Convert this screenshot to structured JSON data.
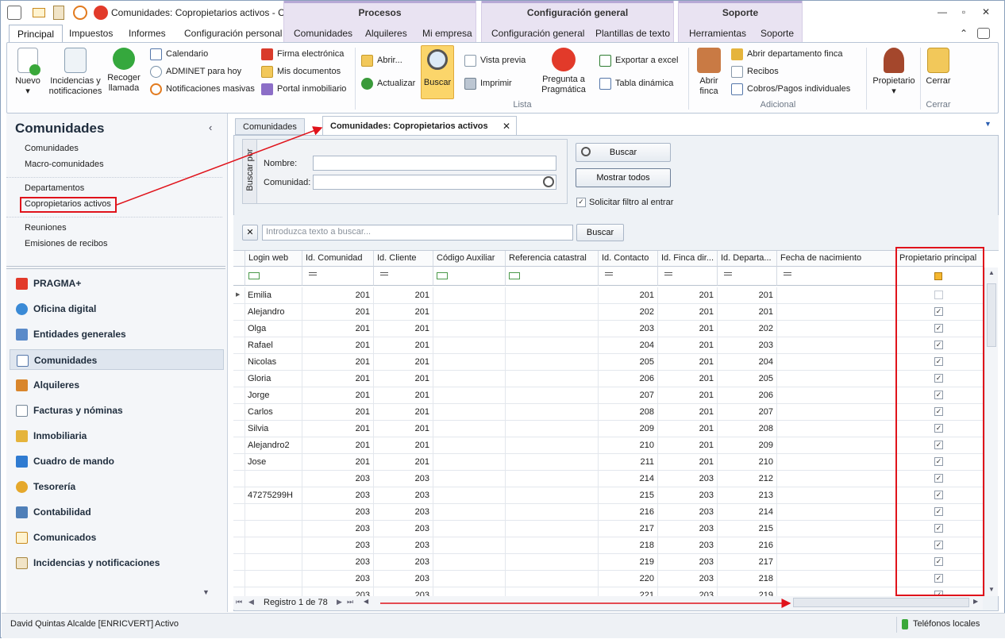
{
  "window": {
    "title": "Comunidades: Copropietarios activos - Con...",
    "context_groups": [
      "Procesos",
      "Configuración general",
      "Soporte"
    ],
    "controls": [
      "—",
      "▫",
      "✕"
    ]
  },
  "ribbon_tabs": [
    "Principal",
    "Impuestos",
    "Informes",
    "Configuración personal",
    "Comunidades",
    "Alquileres",
    "Mi empresa",
    "Configuración general",
    "Plantillas de texto",
    "Herramientas",
    "Soporte"
  ],
  "ribbon": {
    "nuevo": "Nuevo",
    "incidencias": [
      "Incidencias y",
      "notificaciones"
    ],
    "recoger": [
      "Recoger",
      "llamada"
    ],
    "calendario": "Calendario",
    "adminet": "ADMINET para hoy",
    "notificaciones_masivas": "Notificaciones masivas",
    "firma": "Firma electrónica",
    "mis_documentos": "Mis documentos",
    "portal": "Portal inmobiliario",
    "abrir": "Abrir...",
    "actualizar": "Actualizar",
    "buscar": "Buscar",
    "vista_previa": "Vista previa",
    "imprimir": "Imprimir",
    "pregunta": [
      "Pregunta a",
      "Pragmática"
    ],
    "exportar": "Exportar a excel",
    "tabla_dinamica": "Tabla dinámica",
    "abrir_finca": [
      "Abrir",
      "finca"
    ],
    "abrir_departamento": "Abrir departamento finca",
    "recibos": "Recibos",
    "cobros": "Cobros/Pagos individuales",
    "propietario": "Propietario",
    "cerrar": "Cerrar",
    "group_lista": "Lista",
    "group_adicional": "Adicional",
    "group_cerrar": "Cerrar"
  },
  "left_panel": {
    "title": "Comunidades",
    "items": [
      "Comunidades",
      "Macro-comunidades",
      "Departamentos",
      "Copropietarios activos",
      "Reuniones",
      "Emisiones de recibos"
    ],
    "nav": [
      "PRAGMA+",
      "Oficina digital",
      "Entidades generales",
      "Comunidades",
      "Alquileres",
      "Facturas y nóminas",
      "Inmobiliaria",
      "Cuadro de mando",
      "Tesorería",
      "Contabilidad",
      "Comunicados",
      "Incidencias y notificaciones"
    ]
  },
  "doc_tabs": [
    "Comunidades",
    "Comunidades: Copropietarios activos"
  ],
  "search": {
    "group_label": "Buscar por",
    "nombre_label": "Nombre:",
    "comunidad_label": "Comunidad:",
    "buscar_btn": "Buscar",
    "mostrar_btn": "Mostrar todos",
    "filtro_label": "Solicitar filtro al entrar",
    "find_placeholder": "Introduzca texto a buscar...",
    "find_btn": "Buscar"
  },
  "grid": {
    "columns": [
      "Login web",
      "Id. Comunidad",
      "Id. Cliente",
      "Código Auxiliar",
      "Referencia catastral",
      "Id. Contacto",
      "Id. Finca dir...",
      "Id. Departa...",
      "Fecha de nacimiento",
      "Propietario principal"
    ],
    "rows": [
      [
        "Emilia",
        "201",
        "201",
        "",
        "",
        "201",
        "201",
        "201",
        "",
        "0"
      ],
      [
        "Alejandro",
        "201",
        "201",
        "",
        "",
        "202",
        "201",
        "201",
        "",
        "1"
      ],
      [
        "Olga",
        "201",
        "201",
        "",
        "",
        "203",
        "201",
        "202",
        "",
        "1"
      ],
      [
        "Rafael",
        "201",
        "201",
        "",
        "",
        "204",
        "201",
        "203",
        "",
        "1"
      ],
      [
        "Nicolas",
        "201",
        "201",
        "",
        "",
        "205",
        "201",
        "204",
        "",
        "1"
      ],
      [
        "Gloria",
        "201",
        "201",
        "",
        "",
        "206",
        "201",
        "205",
        "",
        "1"
      ],
      [
        "Jorge",
        "201",
        "201",
        "",
        "",
        "207",
        "201",
        "206",
        "",
        "1"
      ],
      [
        "Carlos",
        "201",
        "201",
        "",
        "",
        "208",
        "201",
        "207",
        "",
        "1"
      ],
      [
        "Silvia",
        "201",
        "201",
        "",
        "",
        "209",
        "201",
        "208",
        "",
        "1"
      ],
      [
        "Alejandro2",
        "201",
        "201",
        "",
        "",
        "210",
        "201",
        "209",
        "",
        "1"
      ],
      [
        "Jose",
        "201",
        "201",
        "",
        "",
        "211",
        "201",
        "210",
        "",
        "1"
      ],
      [
        "",
        "203",
        "203",
        "",
        "",
        "214",
        "203",
        "212",
        "",
        "1"
      ],
      [
        "47275299H",
        "203",
        "203",
        "",
        "",
        "215",
        "203",
        "213",
        "",
        "1"
      ],
      [
        "",
        "203",
        "203",
        "",
        "",
        "216",
        "203",
        "214",
        "",
        "1"
      ],
      [
        "",
        "203",
        "203",
        "",
        "",
        "217",
        "203",
        "215",
        "",
        "1"
      ],
      [
        "",
        "203",
        "203",
        "",
        "",
        "218",
        "203",
        "216",
        "",
        "1"
      ],
      [
        "",
        "203",
        "203",
        "",
        "",
        "219",
        "203",
        "217",
        "",
        "1"
      ],
      [
        "",
        "203",
        "203",
        "",
        "",
        "220",
        "203",
        "218",
        "",
        "1"
      ],
      [
        "",
        "203",
        "203",
        "",
        "",
        "221",
        "203",
        "219",
        "",
        "1"
      ]
    ],
    "record_nav": "Registro 1 de 78"
  },
  "status": {
    "user": "David Quintas Alcalde [ENRICVERT]",
    "state": "Activo",
    "phones": "Teléfonos locales"
  }
}
